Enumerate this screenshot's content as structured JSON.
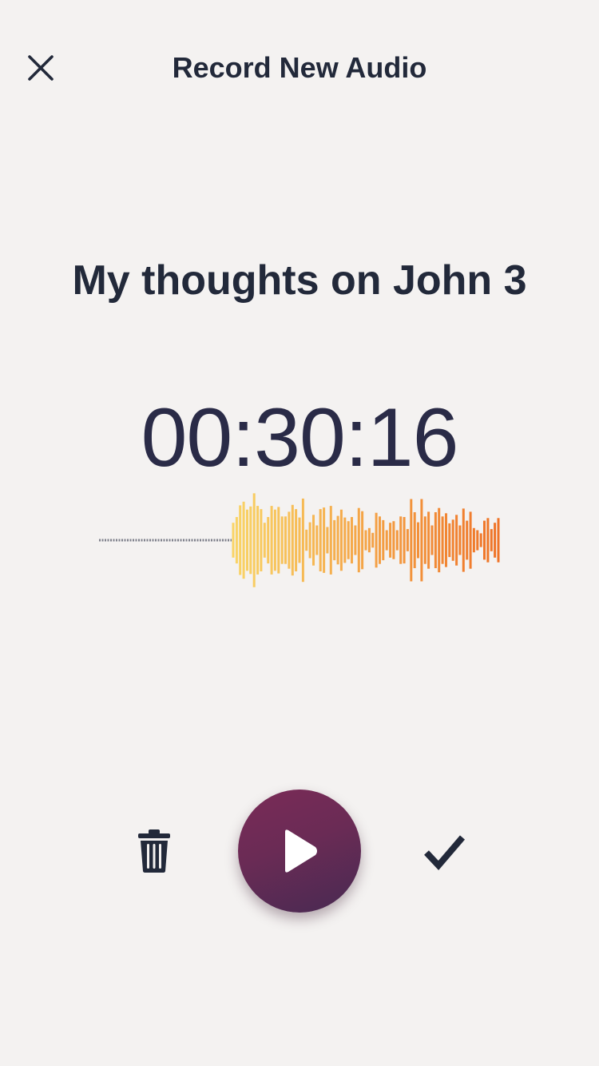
{
  "header": {
    "title": "Record New Audio",
    "close_icon": "close-icon"
  },
  "recording": {
    "title": "My thoughts on John 3",
    "elapsed": "00:30:16"
  },
  "waveform": {
    "gradient_start": "#f9d466",
    "gradient_end": "#ef7327",
    "idle_color": "#7d7f8a",
    "levels": [
      0.33,
      0.44,
      0.66,
      0.73,
      0.58,
      0.64,
      0.89,
      0.65,
      0.59,
      0.33,
      0.44,
      0.65,
      0.58,
      0.63,
      0.45,
      0.45,
      0.54,
      0.67,
      0.59,
      0.43,
      0.79,
      0.2,
      0.34,
      0.48,
      0.28,
      0.59,
      0.62,
      0.25,
      0.65,
      0.38,
      0.46,
      0.58,
      0.43,
      0.36,
      0.44,
      0.28,
      0.61,
      0.55,
      0.19,
      0.23,
      0.14,
      0.52,
      0.45,
      0.38,
      0.19,
      0.33,
      0.36,
      0.19,
      0.45,
      0.44,
      0.21,
      0.78,
      0.53,
      0.34,
      0.78,
      0.45,
      0.54,
      0.28,
      0.53,
      0.61,
      0.45,
      0.51,
      0.32,
      0.39,
      0.48,
      0.28,
      0.6,
      0.37,
      0.54,
      0.23,
      0.19,
      0.13,
      0.37,
      0.42,
      0.21,
      0.33,
      0.42
    ]
  },
  "controls": {
    "delete_icon": "trash-icon",
    "play_icon": "play-icon",
    "confirm_icon": "checkmark-icon",
    "play_button_color": "#6a2b55"
  }
}
